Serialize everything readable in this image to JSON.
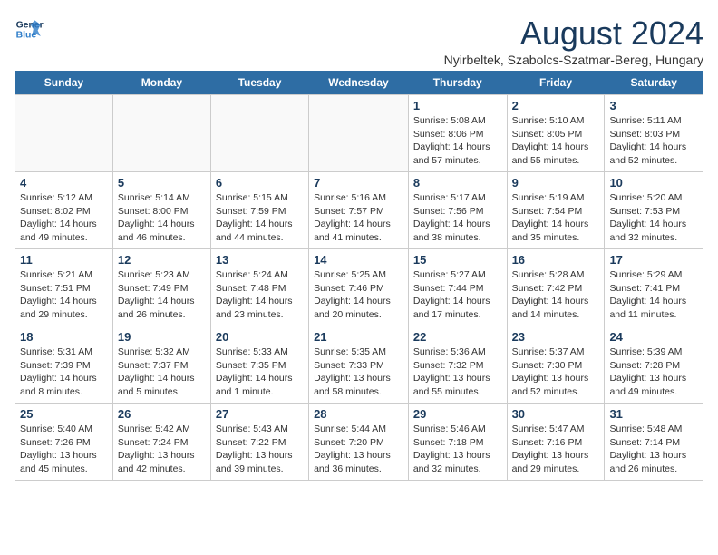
{
  "header": {
    "logo_line1": "General",
    "logo_line2": "Blue",
    "month_title": "August 2024",
    "subtitle": "Nyirbeltek, Szabolcs-Szatmar-Bereg, Hungary"
  },
  "days_of_week": [
    "Sunday",
    "Monday",
    "Tuesday",
    "Wednesday",
    "Thursday",
    "Friday",
    "Saturday"
  ],
  "weeks": [
    [
      {
        "day": "",
        "info": ""
      },
      {
        "day": "",
        "info": ""
      },
      {
        "day": "",
        "info": ""
      },
      {
        "day": "",
        "info": ""
      },
      {
        "day": "1",
        "info": "Sunrise: 5:08 AM\nSunset: 8:06 PM\nDaylight: 14 hours\nand 57 minutes."
      },
      {
        "day": "2",
        "info": "Sunrise: 5:10 AM\nSunset: 8:05 PM\nDaylight: 14 hours\nand 55 minutes."
      },
      {
        "day": "3",
        "info": "Sunrise: 5:11 AM\nSunset: 8:03 PM\nDaylight: 14 hours\nand 52 minutes."
      }
    ],
    [
      {
        "day": "4",
        "info": "Sunrise: 5:12 AM\nSunset: 8:02 PM\nDaylight: 14 hours\nand 49 minutes."
      },
      {
        "day": "5",
        "info": "Sunrise: 5:14 AM\nSunset: 8:00 PM\nDaylight: 14 hours\nand 46 minutes."
      },
      {
        "day": "6",
        "info": "Sunrise: 5:15 AM\nSunset: 7:59 PM\nDaylight: 14 hours\nand 44 minutes."
      },
      {
        "day": "7",
        "info": "Sunrise: 5:16 AM\nSunset: 7:57 PM\nDaylight: 14 hours\nand 41 minutes."
      },
      {
        "day": "8",
        "info": "Sunrise: 5:17 AM\nSunset: 7:56 PM\nDaylight: 14 hours\nand 38 minutes."
      },
      {
        "day": "9",
        "info": "Sunrise: 5:19 AM\nSunset: 7:54 PM\nDaylight: 14 hours\nand 35 minutes."
      },
      {
        "day": "10",
        "info": "Sunrise: 5:20 AM\nSunset: 7:53 PM\nDaylight: 14 hours\nand 32 minutes."
      }
    ],
    [
      {
        "day": "11",
        "info": "Sunrise: 5:21 AM\nSunset: 7:51 PM\nDaylight: 14 hours\nand 29 minutes."
      },
      {
        "day": "12",
        "info": "Sunrise: 5:23 AM\nSunset: 7:49 PM\nDaylight: 14 hours\nand 26 minutes."
      },
      {
        "day": "13",
        "info": "Sunrise: 5:24 AM\nSunset: 7:48 PM\nDaylight: 14 hours\nand 23 minutes."
      },
      {
        "day": "14",
        "info": "Sunrise: 5:25 AM\nSunset: 7:46 PM\nDaylight: 14 hours\nand 20 minutes."
      },
      {
        "day": "15",
        "info": "Sunrise: 5:27 AM\nSunset: 7:44 PM\nDaylight: 14 hours\nand 17 minutes."
      },
      {
        "day": "16",
        "info": "Sunrise: 5:28 AM\nSunset: 7:42 PM\nDaylight: 14 hours\nand 14 minutes."
      },
      {
        "day": "17",
        "info": "Sunrise: 5:29 AM\nSunset: 7:41 PM\nDaylight: 14 hours\nand 11 minutes."
      }
    ],
    [
      {
        "day": "18",
        "info": "Sunrise: 5:31 AM\nSunset: 7:39 PM\nDaylight: 14 hours\nand 8 minutes."
      },
      {
        "day": "19",
        "info": "Sunrise: 5:32 AM\nSunset: 7:37 PM\nDaylight: 14 hours\nand 5 minutes."
      },
      {
        "day": "20",
        "info": "Sunrise: 5:33 AM\nSunset: 7:35 PM\nDaylight: 14 hours\nand 1 minute."
      },
      {
        "day": "21",
        "info": "Sunrise: 5:35 AM\nSunset: 7:33 PM\nDaylight: 13 hours\nand 58 minutes."
      },
      {
        "day": "22",
        "info": "Sunrise: 5:36 AM\nSunset: 7:32 PM\nDaylight: 13 hours\nand 55 minutes."
      },
      {
        "day": "23",
        "info": "Sunrise: 5:37 AM\nSunset: 7:30 PM\nDaylight: 13 hours\nand 52 minutes."
      },
      {
        "day": "24",
        "info": "Sunrise: 5:39 AM\nSunset: 7:28 PM\nDaylight: 13 hours\nand 49 minutes."
      }
    ],
    [
      {
        "day": "25",
        "info": "Sunrise: 5:40 AM\nSunset: 7:26 PM\nDaylight: 13 hours\nand 45 minutes."
      },
      {
        "day": "26",
        "info": "Sunrise: 5:42 AM\nSunset: 7:24 PM\nDaylight: 13 hours\nand 42 minutes."
      },
      {
        "day": "27",
        "info": "Sunrise: 5:43 AM\nSunset: 7:22 PM\nDaylight: 13 hours\nand 39 minutes."
      },
      {
        "day": "28",
        "info": "Sunrise: 5:44 AM\nSunset: 7:20 PM\nDaylight: 13 hours\nand 36 minutes."
      },
      {
        "day": "29",
        "info": "Sunrise: 5:46 AM\nSunset: 7:18 PM\nDaylight: 13 hours\nand 32 minutes."
      },
      {
        "day": "30",
        "info": "Sunrise: 5:47 AM\nSunset: 7:16 PM\nDaylight: 13 hours\nand 29 minutes."
      },
      {
        "day": "31",
        "info": "Sunrise: 5:48 AM\nSunset: 7:14 PM\nDaylight: 13 hours\nand 26 minutes."
      }
    ]
  ]
}
